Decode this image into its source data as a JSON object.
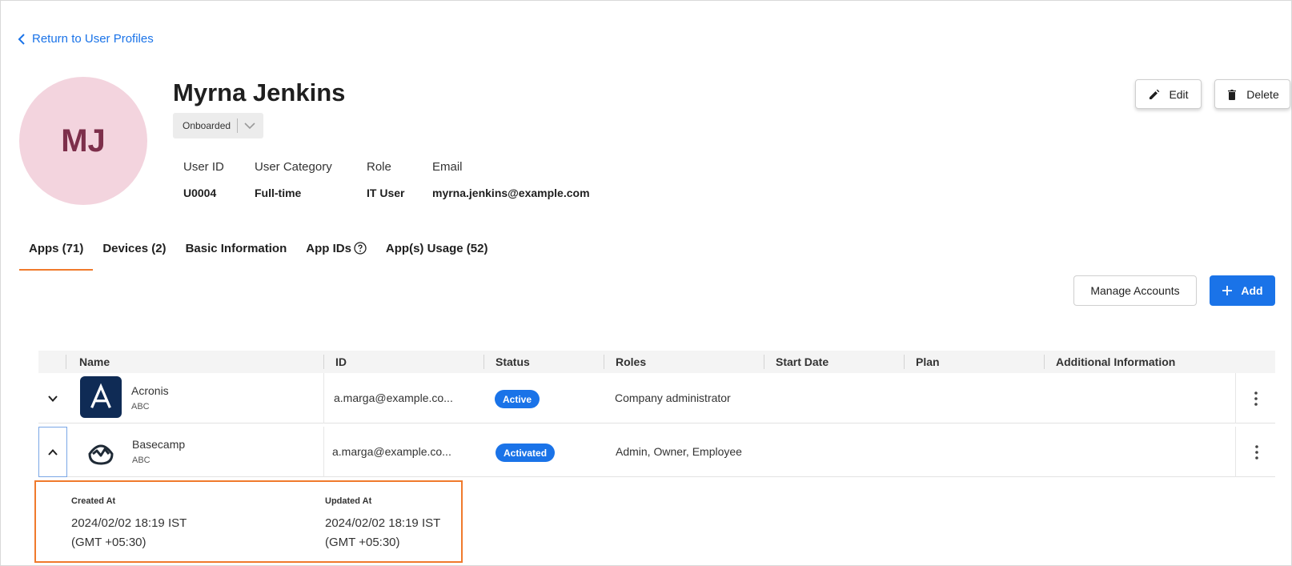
{
  "back_link": {
    "label": "Return to User Profiles",
    "icon": "chevron-left-icon"
  },
  "profile": {
    "initials": "MJ",
    "name": "Myrna Jenkins",
    "status": "Onboarded",
    "avatar_bg": "#f3d4de",
    "avatar_fg": "#7d2f4b"
  },
  "info": [
    {
      "label": "User ID",
      "value": "U0004"
    },
    {
      "label": "User Category",
      "value": "Full-time"
    },
    {
      "label": "Role",
      "value": "IT User"
    },
    {
      "label": "Email",
      "value": "myrna.jenkins@example.com"
    }
  ],
  "actions": {
    "edit": "Edit",
    "delete": "Delete"
  },
  "tabs": [
    {
      "label": "Apps (71)",
      "active": true
    },
    {
      "label": "Devices (2)",
      "active": false
    },
    {
      "label": "Basic Information",
      "active": false
    },
    {
      "label": "App IDs",
      "active": false,
      "icon": "help-circle-icon"
    },
    {
      "label": "App(s) Usage (52)",
      "active": false
    }
  ],
  "toolbar": {
    "manage_accounts": "Manage Accounts",
    "add": "Add"
  },
  "table": {
    "columns": [
      "Name",
      "ID",
      "Status",
      "Roles",
      "Start Date",
      "Plan",
      "Additional Information"
    ],
    "rows": [
      {
        "name": "Acronis",
        "sub": "ABC",
        "id": "a.marga@example.co...",
        "status": "Active",
        "roles": "Company administrator",
        "start_date": "",
        "plan": "",
        "additional": "",
        "expanded": false
      },
      {
        "name": "Basecamp",
        "sub": "ABC",
        "id": "a.marga@example.co...",
        "status": "Activated",
        "roles": "Admin, Owner, Employee",
        "start_date": "",
        "plan": "",
        "additional": "",
        "expanded": true
      }
    ]
  },
  "details": {
    "created_label": "Created At",
    "created_value": "2024/02/02 18:19 IST (GMT +05:30)",
    "updated_label": "Updated At",
    "updated_value": "2024/02/02 18:19 IST (GMT +05:30)"
  },
  "colors": {
    "accent": "#1a73e8",
    "tab_underline": "#f07a2c",
    "highlight_border": "#f07a2c"
  }
}
